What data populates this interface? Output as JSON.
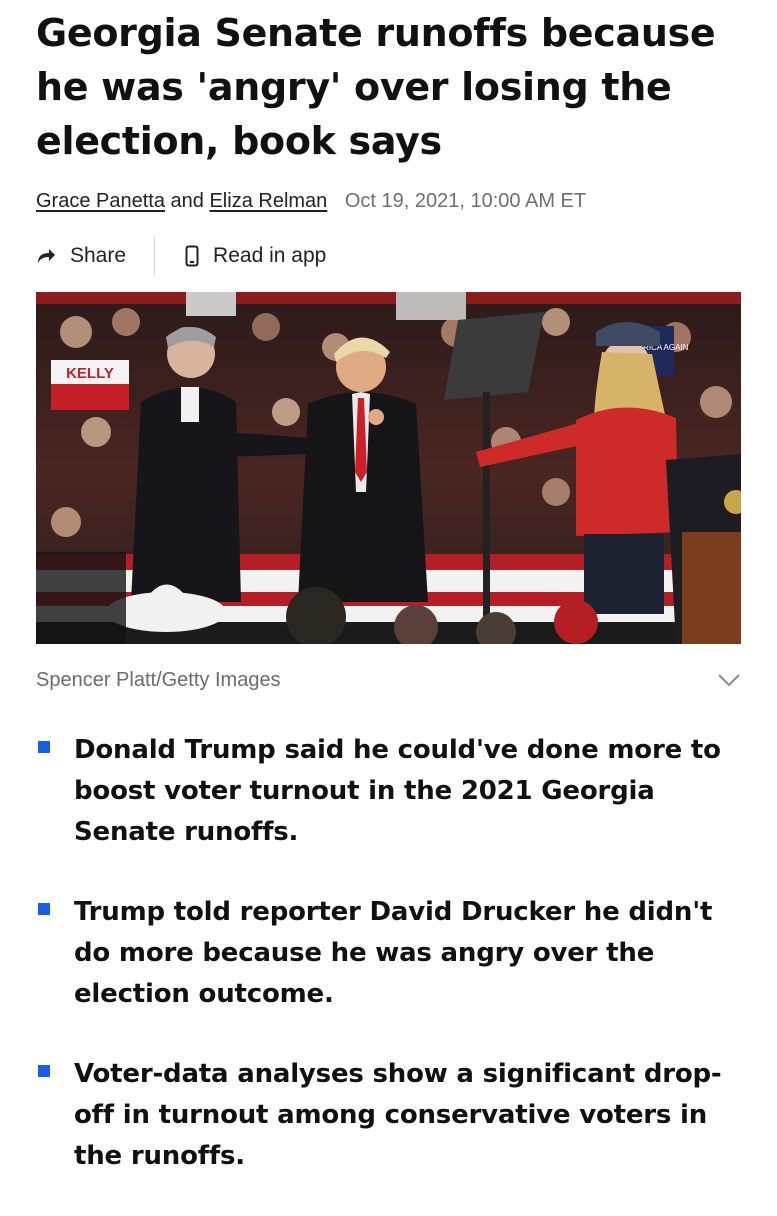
{
  "article": {
    "headline_lines": [
      "Georgia Senate runoffs because",
      "he was 'angry' over losing the",
      "election, book says"
    ],
    "authors": [
      "Grace Panetta",
      "Eliza Relman"
    ],
    "author_joiner": "and",
    "date": "Oct 19, 2021, 10:00 AM ET"
  },
  "actions": {
    "share_label": "Share",
    "read_in_app_label": "Read in app",
    "share_icon": "share-arrow-icon",
    "app_icon": "phone-icon"
  },
  "photo": {
    "sign_text": "KELLY",
    "sign_right_text": "AKE ERICA AGAIN",
    "credit": "Spencer Platt/Getty Images",
    "expand_icon": "chevron-down-icon"
  },
  "bullets": [
    "Donald Trump said he could've done more to boost voter turnout in the 2021 Georgia Senate runoffs.",
    "Trump told reporter David Drucker he didn't do more because he was angry over the election outcome.",
    "Voter-data analyses show a significant drop-off in turnout among conservative voters in the runoffs."
  ],
  "colors": {
    "bullet_accent": "#1a5ee6",
    "meta_gray": "#6f6f6f"
  }
}
